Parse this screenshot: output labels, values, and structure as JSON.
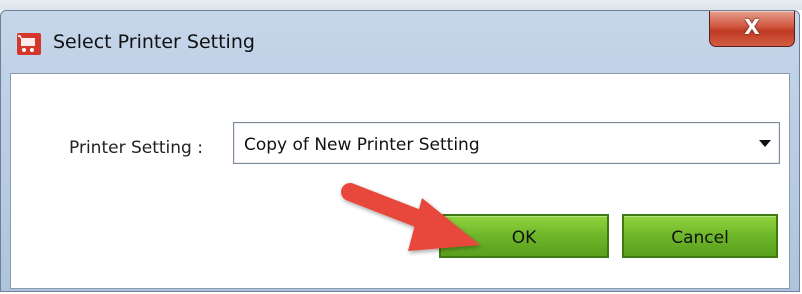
{
  "window": {
    "title": "Select Printer Setting",
    "close_symbol": "X",
    "app_icon": "cart-icon"
  },
  "form": {
    "printer_setting_label": "Printer Setting :",
    "printer_setting_value": "Copy of New Printer Setting"
  },
  "buttons": {
    "ok_label": "OK",
    "cancel_label": "Cancel"
  },
  "colors": {
    "button_green": "#6db62a",
    "close_red": "#c9432b",
    "annotation_arrow": "#e8473a"
  }
}
